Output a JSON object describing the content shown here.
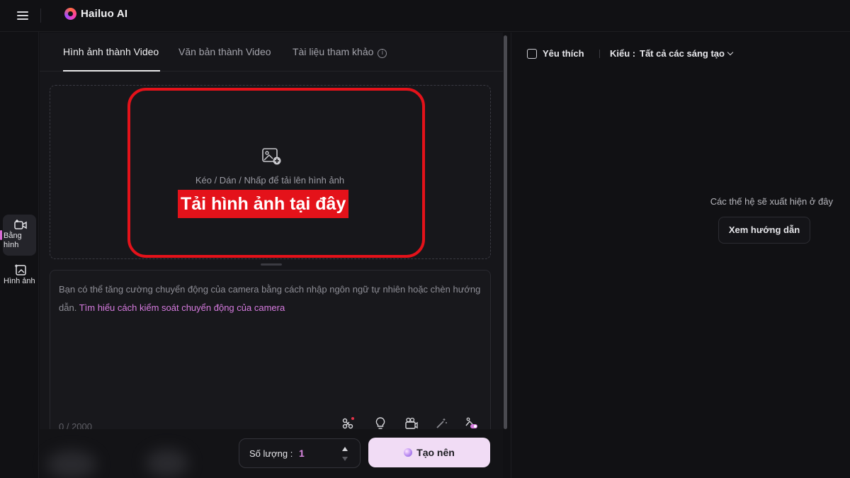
{
  "app": {
    "brand_name": "Hailuo AI"
  },
  "rail": {
    "items": [
      {
        "label": "Bằng hình",
        "icon": "video-plus-icon",
        "active": true
      },
      {
        "label": "Hình ảnh",
        "icon": "image-plus-icon",
        "active": false
      }
    ]
  },
  "tabs": [
    {
      "label": "Hình ảnh thành Video",
      "active": true
    },
    {
      "label": "Văn bản thành Video",
      "active": false
    },
    {
      "label": "Tài liệu tham khảo",
      "active": false,
      "icon": "info-icon"
    }
  ],
  "upload": {
    "hint": "Kéo / Dán / Nhấp để tải lên hình ảnh",
    "callout": "Tải hình ảnh tại đây",
    "icon": "image-upload-icon",
    "highlight_color": "#e4121a"
  },
  "prompt": {
    "placeholder": "Bạn có thể tăng cường chuyển động của camera bằng cách nhập ngôn ngữ tự nhiên hoặc chèn hướng dẫn.",
    "link": "Tìm hiểu cách kiểm soát chuyển động của camera",
    "counter": "0 / 2000",
    "tools": [
      "magic-nodes-icon",
      "bulb-icon",
      "camera-movie-icon",
      "wand-icon",
      "toggle-effect-icon"
    ]
  },
  "quantity": {
    "label": "Số lượng :",
    "value": "1"
  },
  "create": {
    "label": "Tạo nên"
  },
  "right": {
    "favorite_label": "Yêu thích",
    "type_label": "Kiểu :",
    "type_value": "Tất cả các sáng tạo",
    "empty_message": "Các thế hệ sẽ xuất hiện ở đây",
    "guide_button": "Xem hướng dẫn"
  },
  "colors": {
    "accent": "#d77be0",
    "create_bg": "#f1dcf5",
    "background": "#111114",
    "panel": "#16161a"
  }
}
